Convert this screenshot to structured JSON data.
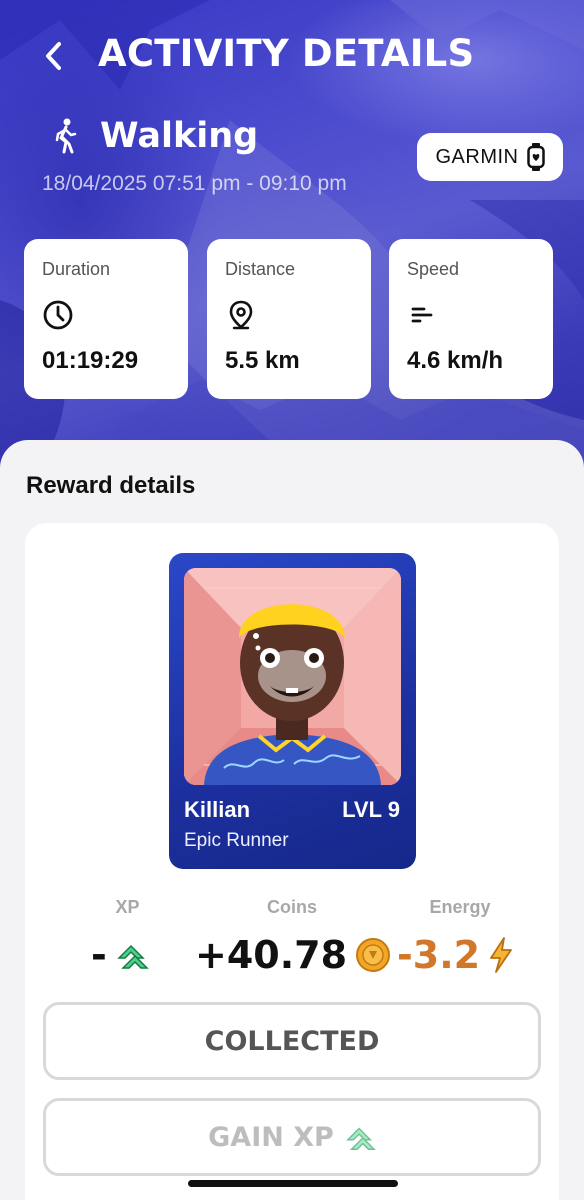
{
  "header": {
    "title": "ACTIVITY DETAILS"
  },
  "activity": {
    "name": "Walking",
    "time_range": "18/04/2025 07:51 pm - 09:10 pm",
    "device": "GARMIN"
  },
  "stats": [
    {
      "label": "Duration",
      "value": "01:19:29",
      "icon": "clock-icon"
    },
    {
      "label": "Distance",
      "value": "5.5 km",
      "icon": "location-pin-icon"
    },
    {
      "label": "Speed",
      "value": "4.6 km/h",
      "icon": "speed-lines-icon"
    }
  ],
  "rewards": {
    "section_title": "Reward details",
    "character": {
      "name": "Killian",
      "level": "LVL 9",
      "title": "Epic Runner"
    },
    "xp": {
      "label": "XP",
      "value": "-"
    },
    "coins": {
      "label": "Coins",
      "value": "+40.78"
    },
    "energy": {
      "label": "Energy",
      "value": "-3.2"
    },
    "collected_button": "COLLECTED",
    "gain_xp_button": "GAIN XP"
  },
  "colors": {
    "energy": "#d2772a",
    "xp_icon": "#3fc47a",
    "coin": "#f2a628",
    "card_blue": "#2440b8"
  }
}
